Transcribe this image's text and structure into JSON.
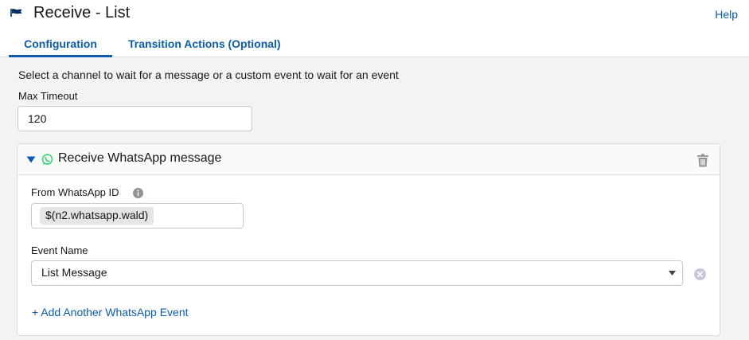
{
  "header": {
    "title": "Receive - List",
    "help_label": "Help",
    "flag_icon": "flag-icon",
    "accent": "#0b5cab"
  },
  "tabs": [
    {
      "label": "Configuration",
      "active": true
    },
    {
      "label": "Transition Actions (Optional)",
      "active": false
    }
  ],
  "config": {
    "intro": "Select a channel to wait for a message or a custom event to wait for an event",
    "max_timeout_label": "Max Timeout",
    "max_timeout_value": "120"
  },
  "channel_card": {
    "title": "Receive WhatsApp message",
    "channel_icon": "whatsapp-icon",
    "brand_color": "#25d366",
    "from_label": "From WhatsApp ID",
    "from_value": "$(n2.whatsapp.wald)",
    "event_label": "Event Name",
    "event_value": "List Message",
    "add_event_label": "+ Add Another WhatsApp Event"
  }
}
